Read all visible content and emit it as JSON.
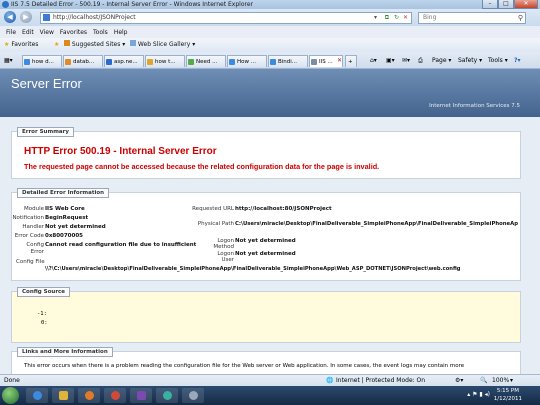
{
  "window": {
    "title": "IIS 7.5 Detailed Error - 500.19 - Internal Server Error - Windows Internet Explorer",
    "controls": [
      "–",
      "□",
      "✕"
    ]
  },
  "address": {
    "url": "http://localhost/JSONProject",
    "search_placeholder": "Bing"
  },
  "menu": [
    "File",
    "Edit",
    "View",
    "Favorites",
    "Tools",
    "Help"
  ],
  "favorites_bar": {
    "favorites": "Favorites",
    "suggested": "Suggested Sites ▾",
    "web_slice": "Web Slice Gallery ▾"
  },
  "tabs": [
    {
      "label": "how d..."
    },
    {
      "label": "datab..."
    },
    {
      "label": "asp.ne..."
    },
    {
      "label": "how t..."
    },
    {
      "label": "Need ..."
    },
    {
      "label": "How ..."
    },
    {
      "label": "Bindi..."
    },
    {
      "label": "IIS ..."
    }
  ],
  "toolbar": {
    "page": "Page ▾",
    "safety": "Safety ▾",
    "tools": "Tools ▾",
    "help": "?▾"
  },
  "page": {
    "header": "Server Error",
    "iis_version": "Internet Information Services 7.5",
    "summary_legend": "Error Summary",
    "error_title": "HTTP Error 500.19 - Internal Server Error",
    "error_text": "The requested page cannot be accessed because the related configuration data for the page is invalid.",
    "detail_legend": "Detailed Error Information",
    "details_left": [
      {
        "key": "Module",
        "value": "IIS Web Core"
      },
      {
        "key": "Notification",
        "value": "BeginRequest"
      },
      {
        "key": "Handler",
        "value": "Not yet determined"
      },
      {
        "key": "Error Code",
        "value": "0x80070005"
      },
      {
        "key": "Config Error",
        "value": "Cannot read configuration file due to insufficient"
      },
      {
        "key": "Config File",
        "value": "\\\\?\\C:\\Users\\miracle\\Desktop\\FinalDeliverable_SimpleiPhoneApp\\FinalDeliverable_SimpleiPhoneApp\\Web_ASP_DOTNET\\JSONProject\\web.config"
      }
    ],
    "details_right": [
      {
        "key": "Requested URL",
        "value": "http://localhost:80/JSONProject"
      },
      {
        "key": "Physical Path",
        "value": "C:\\Users\\miracle\\Desktop\\FinalDeliverable_SimpleiPhoneApp\\FinalDeliverable_SimpleiPhoneApp\\Web_ASP_DOTNET\\JSONProject"
      },
      {
        "key": "Logon Method",
        "value": "Not yet determined"
      },
      {
        "key": "Logon User",
        "value": "Not yet determined"
      }
    ],
    "source_legend": "Config Source",
    "source_lines": [
      "-1:",
      "0:"
    ],
    "links_legend": "Links and More Information",
    "links_text": "This error occurs when there is a problem reading the configuration file for the Web server or Web application. In some cases, the event logs may contain more"
  },
  "status": {
    "left": "Done",
    "zone": "Internet | Protected Mode: On",
    "zoom": "100%"
  },
  "taskbar": {
    "time": "5:15 PM",
    "date": "1/12/2011"
  },
  "colors": {
    "header": "#4f6f9a",
    "error_red": "#cc0000",
    "source_bg": "#fffbdc"
  }
}
